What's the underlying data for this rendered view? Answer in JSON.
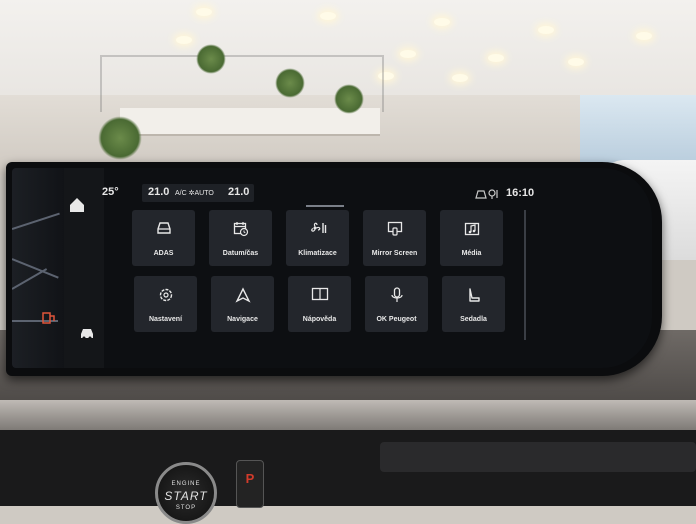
{
  "status_bar": {
    "outside_temp": "25°",
    "left_temp": "21.0",
    "climate_mode": "A/C ✲AUTO",
    "right_temp": "21.0",
    "time": "16:10"
  },
  "apps": [
    {
      "label": "ADAS",
      "icon": "car-icon"
    },
    {
      "label": "Datum/čas",
      "icon": "calendar-clock-icon"
    },
    {
      "label": "Klimatizace",
      "icon": "fan-icon"
    },
    {
      "label": "Mirror Screen",
      "icon": "mirror-screen-icon"
    },
    {
      "label": "Média",
      "icon": "music-note-icon"
    },
    {
      "label": "Nastavení",
      "icon": "gear-icon"
    },
    {
      "label": "Navigace",
      "icon": "navigation-arrow-icon"
    },
    {
      "label": "Nápověda",
      "icon": "book-icon"
    },
    {
      "label": "OK Peugeot",
      "icon": "microphone-icon"
    },
    {
      "label": "Sedadla",
      "icon": "seat-icon"
    }
  ],
  "console": {
    "start_top": "ENGINE",
    "start_main": "START",
    "start_bottom": "STOP",
    "park_label": "P"
  }
}
